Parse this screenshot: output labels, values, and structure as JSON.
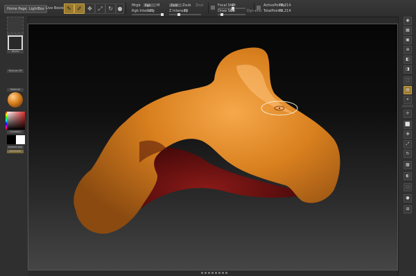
{
  "topbar": {
    "home_page": "Home Page",
    "lightbox": "LightBox",
    "live_boolean": "Live Boolean",
    "tools": [
      "E",
      "M",
      "S",
      "R",
      "Sc"
    ],
    "mrgb": "Mrgb",
    "rgb": "Rgb",
    "m": "M",
    "zadd": "Zadd",
    "zsub": "Zsub",
    "zcut": "Zcut",
    "focal_shift_label": "Focal Shift",
    "focal_shift_value": "0",
    "draw_size_label": "Draw Size",
    "draw_size_value": "64",
    "dynamic_label": "Dynamic",
    "rgb_intensity_label": "Rgb Intensity",
    "rgb_intensity_value": "100",
    "z_intensity_label": "Z Intensity",
    "z_intensity_value": "25",
    "active_points_label": "ActivePoints:",
    "active_points_value": "78,214",
    "total_points_label": "TotalPoints:",
    "total_points_value": "78,214"
  },
  "left_panel": {
    "labels": [
      "",
      "Alpha",
      "Texture Off",
      "Material",
      "Gradient",
      "SwitchColor",
      "Alternate"
    ]
  },
  "right_panel": {
    "buttons": [
      "BPR",
      "SPix",
      "Scroll",
      "Zoom",
      "Actual",
      "AAHalf",
      "Persp",
      "Floor",
      "Local",
      "Frame",
      "Move",
      "Scale",
      "Rotate",
      "PolyF",
      "Transp",
      "Ghost",
      "Solo",
      "Xpose"
    ]
  },
  "colors": {
    "mesh": "#d9801f",
    "mesh_shadow": "#6e1212",
    "active_tool": "#9a7a2e"
  }
}
